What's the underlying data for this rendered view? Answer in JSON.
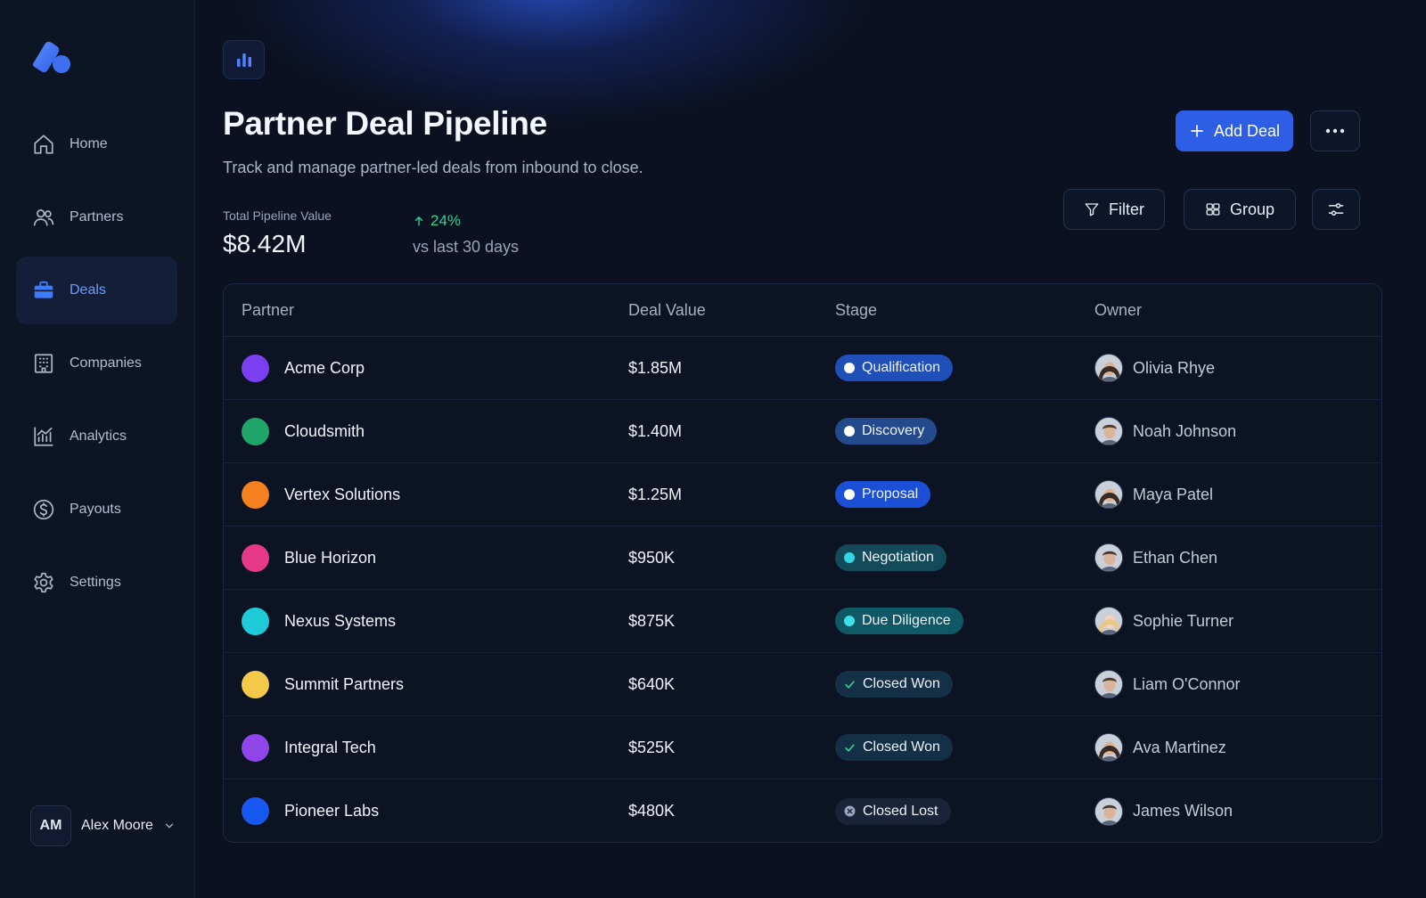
{
  "sidebar": {
    "items": [
      {
        "label": "Home",
        "icon": "home-icon"
      },
      {
        "label": "Partners",
        "icon": "users-icon"
      },
      {
        "label": "Deals",
        "icon": "briefcase-icon",
        "active": true
      },
      {
        "label": "Companies",
        "icon": "building-icon"
      },
      {
        "label": "Analytics",
        "icon": "analytics-icon"
      },
      {
        "label": "Payouts",
        "icon": "dollar-icon"
      },
      {
        "label": "Settings",
        "icon": "gear-icon"
      }
    ],
    "user": {
      "initials": "AM",
      "name": "Alex Moore"
    }
  },
  "header": {
    "title": "Partner Deal Pipeline",
    "subtitle": "Track and manage partner-led deals from inbound to close.",
    "add_label": "Add Deal",
    "filter_label": "Filter",
    "group_label": "Group"
  },
  "stats": {
    "label": "Total Pipeline Value",
    "value": "$8.42M",
    "delta": "24%",
    "delta_caption": "vs last 30 days"
  },
  "table": {
    "columns": [
      "Partner",
      "Deal Value",
      "Stage",
      "Owner"
    ],
    "rows": [
      {
        "partner": "Acme Corp",
        "color": "#7b3ff2",
        "value": "$1.85M",
        "stage": "Qualification",
        "stage_kind": "dot",
        "stage_bg": "#1f4fb8",
        "stage_dot": "#ffffff",
        "owner": "Olivia Rhye",
        "avatar": "female"
      },
      {
        "partner": "Cloudsmith",
        "color": "#1fa56a",
        "value": "$1.40M",
        "stage": "Discovery",
        "stage_kind": "dot",
        "stage_bg": "#244a8e",
        "stage_dot": "#ffffff",
        "owner": "Noah Johnson",
        "avatar": "male"
      },
      {
        "partner": "Vertex Solutions",
        "color": "#f58020",
        "value": "$1.25M",
        "stage": "Proposal",
        "stage_kind": "dot",
        "stage_bg": "#1a4fd6",
        "stage_dot": "#ffffff",
        "owner": "Maya Patel",
        "avatar": "female"
      },
      {
        "partner": "Blue Horizon",
        "color": "#e7388a",
        "value": "$950K",
        "stage": "Negotiation",
        "stage_kind": "dot",
        "stage_bg": "#134a5a",
        "stage_dot": "#34d6e3",
        "owner": "Ethan Chen",
        "avatar": "male"
      },
      {
        "partner": "Nexus Systems",
        "color": "#1ec9d8",
        "value": "$875K",
        "stage": "Due Diligence",
        "stage_kind": "dot",
        "stage_bg": "#0f5866",
        "stage_dot": "#3fe0ec",
        "owner": "Sophie Turner",
        "avatar": "female-light"
      },
      {
        "partner": "Summit Partners",
        "color": "#f4c94a",
        "value": "$640K",
        "stage": "Closed Won",
        "stage_kind": "check",
        "stage_bg": "#133046",
        "stage_dot": "#34d399",
        "owner": "Liam O'Connor",
        "avatar": "male"
      },
      {
        "partner": "Integral Tech",
        "color": "#8e46ea",
        "value": "$525K",
        "stage": "Closed Won",
        "stage_kind": "check",
        "stage_bg": "#133046",
        "stage_dot": "#34d399",
        "owner": "Ava Martinez",
        "avatar": "female"
      },
      {
        "partner": "Pioneer Labs",
        "color": "#1658f0",
        "value": "$480K",
        "stage": "Closed Lost",
        "stage_kind": "x",
        "stage_bg": "#1a2438",
        "stage_dot": "#9aa6bb",
        "owner": "James Wilson",
        "avatar": "male"
      }
    ]
  }
}
